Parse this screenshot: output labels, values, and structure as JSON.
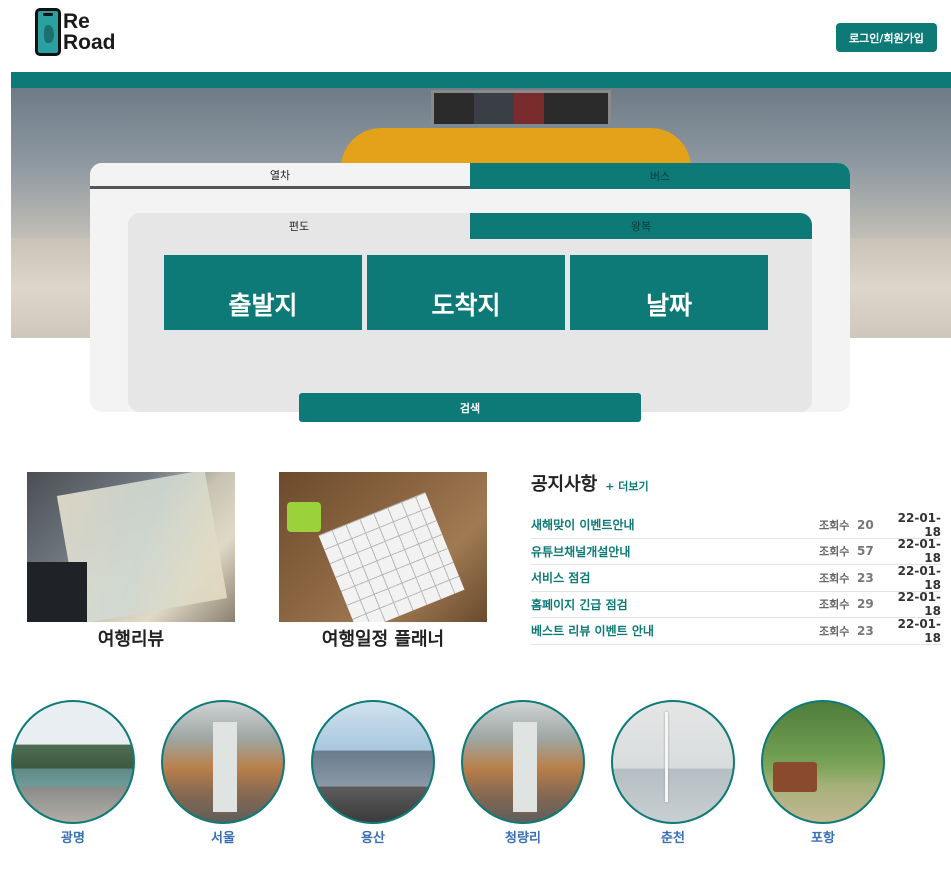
{
  "header": {
    "logo_line1": "Re",
    "logo_line2": "Road",
    "login_label": "로그인/회원가입"
  },
  "search": {
    "transport_tabs": [
      "열차",
      "버스"
    ],
    "trip_tabs": [
      "편도",
      "왕복"
    ],
    "fields": [
      "출발지",
      "도착지",
      "날짜"
    ],
    "button_label": "검색"
  },
  "cards": [
    {
      "label": "여행리뷰"
    },
    {
      "label": "여행일정 플래너"
    }
  ],
  "notice": {
    "title": "공지사항",
    "more_label": "+ 더보기",
    "view_label": "조회수",
    "items": [
      {
        "title": "새해맞이 이벤트안내",
        "views": "20",
        "date": "22-01-18"
      },
      {
        "title": "유튜브채널개설안내",
        "views": "57",
        "date": "22-01-18"
      },
      {
        "title": "서비스 점검",
        "views": "23",
        "date": "22-01-18"
      },
      {
        "title": "홈페이지 긴급 점검",
        "views": "29",
        "date": "22-01-18"
      },
      {
        "title": "베스트 리뷰 이벤트 안내",
        "views": "23",
        "date": "22-01-18"
      }
    ]
  },
  "cities": [
    "광명",
    "서울",
    "용산",
    "청량리",
    "춘천",
    "포항"
  ],
  "colors": {
    "accent": "#0d7a77",
    "city_label": "#3a6fb3"
  }
}
